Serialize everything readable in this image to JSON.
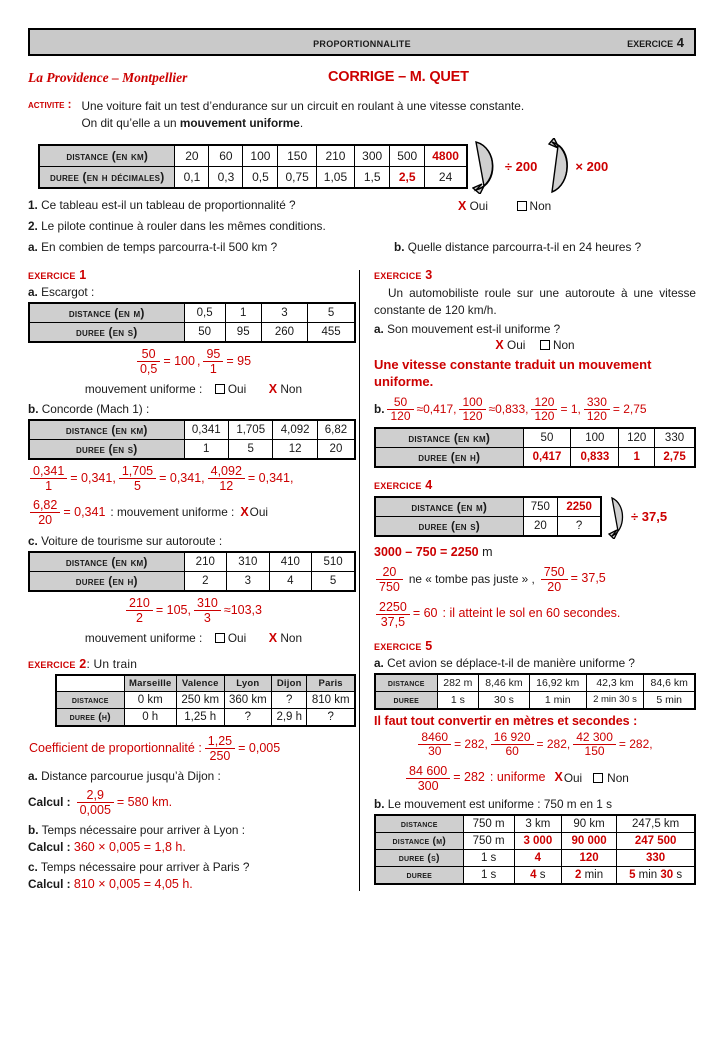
{
  "header": {
    "title": "PROPORTIONNALITE",
    "exercise": "EXERCICE 4"
  },
  "school": "La Providence – Montpellier",
  "corrige": "CORRIGE – M. QUET",
  "activity": {
    "label": "ACTIVITE :",
    "line1": "Une voiture fait un test d’endurance sur un circuit en roulant à une vitesse constante.",
    "line2_prefix": "On dit qu’elle a un ",
    "line2_bold": "mouvement uniforme",
    "line2_suffix": ".",
    "table": {
      "row1_header": "DISTANCE (en km)",
      "row1": [
        "20",
        "60",
        "100",
        "150",
        "210",
        "300",
        "500",
        "4800"
      ],
      "row2_header": "DUREE (en h décimales)",
      "row2": [
        "0,1",
        "0,3",
        "0,5",
        "0,75",
        "1,05",
        "1,5",
        "2,5",
        "24"
      ]
    },
    "arrow_div": "÷ 200",
    "arrow_mul": "× 200",
    "q1_num": "1.",
    "q1": "Ce tableau est-il un tableau de proportionnalité ?",
    "q1_oui": "Oui",
    "q1_non": "Non",
    "q2_num": "2.",
    "q2": "Le pilote continue à rouler dans les mêmes conditions.",
    "qa_num": "a.",
    "qa": "En combien de temps parcourra-t-il 500 km ?",
    "qb_num": "b.",
    "qb": "Quelle distance parcourra-t-il en 24 heures ?"
  },
  "ex1": {
    "title": "EXERCICE 1",
    "a_label": "a.",
    "a_text": "Escargot :",
    "a_table": {
      "h1": "DISTANCE (en m)",
      "r1": [
        "0,5",
        "1",
        "3",
        "5"
      ],
      "h2": "DUREE (en s)",
      "r2": [
        "50",
        "95",
        "260",
        "455"
      ]
    },
    "a_math": [
      {
        "num": "50",
        "den": "0,5",
        "res": "= 100"
      },
      {
        "num": "95",
        "den": "1",
        "res": "= 95"
      }
    ],
    "a_uniform_label": "mouvement uniforme :",
    "a_oui": "Oui",
    "a_non": "Non",
    "a_answer": "Non",
    "b_label": "b.",
    "b_text": "Concorde (Mach 1) :",
    "b_table": {
      "h1": "DISTANCE (en km)",
      "r1": [
        "0,341",
        "1,705",
        "4,092",
        "6,82"
      ],
      "h2": "DUREE (en s)",
      "r2": [
        "1",
        "5",
        "12",
        "20"
      ]
    },
    "b_math": [
      {
        "num": "0,341",
        "den": "1",
        "res": "= 0,341,"
      },
      {
        "num": "1,705",
        "den": "5",
        "res": "= 0,341,"
      },
      {
        "num": "4,092",
        "den": "12",
        "res": "= 0,341,"
      }
    ],
    "b_math2": {
      "num": "6,82",
      "den": "20",
      "res": "= 0,341"
    },
    "b_tail": ": mouvement uniforme :",
    "b_answer": "Oui",
    "c_label": "c.",
    "c_text": "Voiture de tourisme sur autoroute :",
    "c_table": {
      "h1": "DISTANCE (en km)",
      "r1": [
        "210",
        "310",
        "410",
        "510"
      ],
      "h2": "DUREE (en h)",
      "r2": [
        "2",
        "3",
        "4",
        "5"
      ]
    },
    "c_math": [
      {
        "num": "210",
        "den": "2",
        "res": "= 105,"
      },
      {
        "num": "310",
        "den": "3",
        "res": "≈103,3"
      }
    ],
    "c_uniform_label": "mouvement uniforme :",
    "c_oui": "Oui",
    "c_non": "Non",
    "c_answer": "Non"
  },
  "ex2": {
    "title": "EXERCICE 2",
    "subtitle": ": Un train",
    "table": {
      "cols": [
        "Marseille",
        "Valence",
        "Lyon",
        "Dijon",
        "Paris"
      ],
      "h1": "DISTANCE",
      "r1": [
        "0 km",
        "250 km",
        "360 km",
        "?",
        "810 km"
      ],
      "h2": "DUREE (H)",
      "r2": [
        "0 h",
        "1,25 h",
        "?",
        "2,9 h",
        "?"
      ]
    },
    "coef_label": "Coefficient de proportionnalité :",
    "coef": {
      "num": "1,25",
      "den": "250",
      "res": "= 0,005"
    },
    "a_label": "a.",
    "a_text": "Distance parcourue jusqu’à Dijon :",
    "a_calc_label": "Calcul :",
    "a_calc": {
      "num": "2,9",
      "den": "0,005",
      "res": "= 580 km."
    },
    "b_label": "b.",
    "b_text": "Temps nécessaire pour arriver à Lyon :",
    "b_calc_label": "Calcul :",
    "b_calc": "360 × 0,005 = 1,8 h.",
    "c_label": "c.",
    "c_text": "Temps nécessaire pour arriver à Paris ?",
    "c_calc_label": "Calcul :",
    "c_calc": "810 × 0,005 = 4,05 h."
  },
  "ex3": {
    "title": "EXERCICE 3",
    "intro": "Un automobiliste roule sur une autoroute à une vitesse constante de 120 km/h.",
    "a_label": "a.",
    "a_text": "Son mouvement est-il uniforme ?",
    "a_oui": "Oui",
    "a_non": "Non",
    "statement": "Une vitesse constante traduit un mouvement uniforme.",
    "b_label": "b.",
    "b_math": [
      {
        "num": "50",
        "den": "120",
        "res": "≈0,417,"
      },
      {
        "num": "100",
        "den": "120",
        "res": "≈0,833,"
      },
      {
        "num": "120",
        "den": "120",
        "res": "= 1,"
      },
      {
        "num": "330",
        "den": "120",
        "res": "= 2,75"
      }
    ],
    "table": {
      "h1": "DISTANCE (en km)",
      "r1": [
        "50",
        "100",
        "120",
        "330"
      ],
      "h2": "DUREE (en h)",
      "r2": [
        "0,417",
        "0,833",
        "1",
        "2,75"
      ]
    }
  },
  "ex4": {
    "title": "EXERCICE 4",
    "table": {
      "h1": "DISTANCE (en m)",
      "r1": [
        "750",
        "2250"
      ],
      "h2": "DUREE (en s)",
      "r2": [
        "20",
        "?"
      ]
    },
    "arrow": "÷ 37,5",
    "line1_red": "3000 – 750 = 2250",
    "line1_tail": "m",
    "m1": {
      "num": "20",
      "den": "750"
    },
    "m1_text": "ne « tombe pas juste » ,",
    "m2": {
      "num": "750",
      "den": "20",
      "res": "= 37,5"
    },
    "m3": {
      "num": "2250",
      "den": "37,5",
      "res": "= 60"
    },
    "m3_tail": ": il atteint le sol en 60 secondes."
  },
  "ex5": {
    "title": "EXERCICE 5",
    "a_label": "a.",
    "a_text": "Cet avion se déplace-t-il de manière uniforme ?",
    "table_a": {
      "h1": "DISTANCE",
      "r1": [
        "282 m",
        "8,46 km",
        "16,92 km",
        "42,3 km",
        "84,6 km"
      ],
      "h2": "DUREE",
      "r2": [
        "1 s",
        "30 s",
        "1 min",
        "2 min 30 s",
        "5 min"
      ]
    },
    "convert": "Il faut tout convertir en mètres et secondes :",
    "math": [
      {
        "num": "8460",
        "den": "30",
        "res": "= 282,"
      },
      {
        "num": "16 920",
        "den": "60",
        "res": "= 282,"
      },
      {
        "num": "42 300",
        "den": "150",
        "res": "= 282,"
      }
    ],
    "math2": {
      "num": "84 600",
      "den": "300",
      "res": "= 282"
    },
    "math2_tail": ": uniforme",
    "oui": "Oui",
    "non": "Non",
    "b_label": "b.",
    "b_text": "Le mouvement est uniforme : 750 m en 1 s",
    "table_b": {
      "h1": "DISTANCE",
      "r1": [
        "750 m",
        "3 km",
        "90 km",
        "247,5 km"
      ],
      "h2": "DISTANCE (m)",
      "r2": [
        "750 m",
        "3 000",
        "90 000",
        "247 500"
      ],
      "h3": "DUREE (s)",
      "r3": [
        "1 s",
        "4",
        "120",
        "330"
      ],
      "h4": "DUREE",
      "r4_plain": [
        "1 s"
      ],
      "r4": [
        "4 s",
        "2 min",
        "5 min 30 s"
      ]
    }
  },
  "colors": {
    "red": "#cc0000",
    "gray_header": "#c9c9c9",
    "gray_cell": "#cfcfcf"
  }
}
